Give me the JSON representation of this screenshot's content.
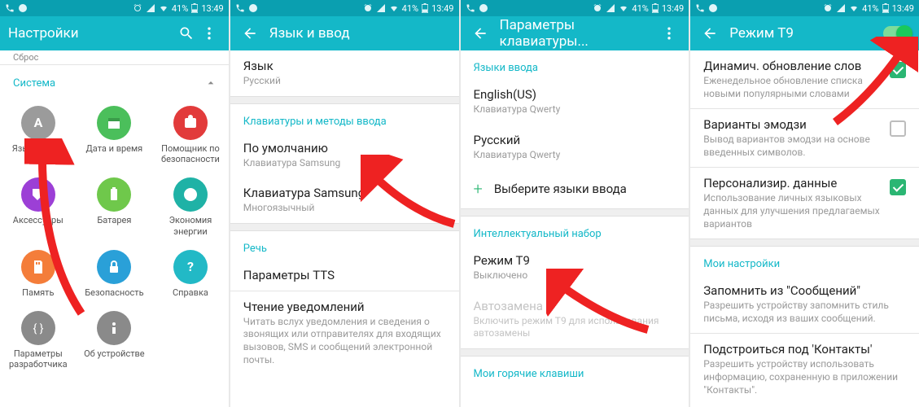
{
  "status": {
    "battery": "41%",
    "time": "13:49"
  },
  "p1": {
    "title": "Настройки",
    "truncated": "Сброс",
    "section": "Система",
    "items": [
      {
        "label": "Язык и ввод",
        "color": "#9b9b9b",
        "icon": "A"
      },
      {
        "label": "Дата и время",
        "color": "#4bbf5b",
        "icon": "cal"
      },
      {
        "label": "Помощник по безопасности",
        "color": "#e23b3b",
        "icon": "warn"
      },
      {
        "label": "Аксессуары",
        "color": "#9c3fd6",
        "icon": "tag"
      },
      {
        "label": "Батарея",
        "color": "#6fc84b",
        "icon": "bat"
      },
      {
        "label": "Экономия энергии",
        "color": "#1fb2a6",
        "icon": "leaf"
      },
      {
        "label": "Память",
        "color": "#f47d3a",
        "icon": "sd"
      },
      {
        "label": "Безопасность",
        "color": "#2aa0d8",
        "icon": "lock"
      },
      {
        "label": "Справка",
        "color": "#22b9c6",
        "icon": "help"
      },
      {
        "label": "Параметры разработчика",
        "color": "#8a8a8a",
        "icon": "dev"
      },
      {
        "label": "Об устройстве",
        "color": "#8a8a8a",
        "icon": "info"
      }
    ]
  },
  "p2": {
    "title": "Язык и ввод",
    "rows": [
      {
        "type": "item",
        "t": "Язык",
        "s": "Русский"
      },
      {
        "type": "div"
      },
      {
        "type": "header",
        "t": "Клавиатуры и методы ввода"
      },
      {
        "type": "item",
        "t": "По умолчанию",
        "s": "Клавиатура Samsung"
      },
      {
        "type": "item",
        "t": "Клавиатура Samsung",
        "s": "Многоязычный"
      },
      {
        "type": "div"
      },
      {
        "type": "header",
        "t": "Речь"
      },
      {
        "type": "item",
        "t": "Параметры TTS"
      },
      {
        "type": "hr"
      },
      {
        "type": "item",
        "t": "Чтение уведомлений",
        "s": "Читать вслух уведомления и сведения о звонящих или отправителях для входящих вызовов, SMS и сообщений электронной почты."
      }
    ]
  },
  "p3": {
    "title": "Параметры клавиатуры...",
    "rows": [
      {
        "type": "header",
        "t": "Языки ввода"
      },
      {
        "type": "item",
        "t": "English(US)",
        "s": "Клавиатура Qwerty"
      },
      {
        "type": "item",
        "t": "Русский",
        "s": "Клавиатура Qwerty"
      },
      {
        "type": "add",
        "t": "Выберите языки ввода"
      },
      {
        "type": "div"
      },
      {
        "type": "header",
        "t": "Интеллектуальный набор"
      },
      {
        "type": "item",
        "t": "Режим Т9",
        "s": "Выключено"
      },
      {
        "type": "item",
        "t": "Автозамена",
        "s": "Включить режим Т9 для использования автозамены",
        "dis": true
      },
      {
        "type": "div"
      },
      {
        "type": "header",
        "t": "Мои горячие клавиши"
      }
    ]
  },
  "p4": {
    "title": "Режим Т9",
    "rows": [
      {
        "type": "check",
        "t": "Динамич. обновление слов",
        "s": "Еженедельное обновление списка новыми популярными словами",
        "on": true
      },
      {
        "type": "hr"
      },
      {
        "type": "check",
        "t": "Варианты эмодзи",
        "s": "Вывод вариантов эмодзи на основе введенных символов.",
        "on": false
      },
      {
        "type": "hr"
      },
      {
        "type": "check",
        "t": "Персонализир. данные",
        "s": "Использование личных языковых данных для улучшения предлагаемых вариантов",
        "on": true
      },
      {
        "type": "div"
      },
      {
        "type": "header",
        "t": "Мои настройки"
      },
      {
        "type": "item",
        "t": "Запомнить из \"Сообщений\"",
        "s": "Разрешить устройству запомнить стиль письма, исходя из ваших сообщений."
      },
      {
        "type": "hr"
      },
      {
        "type": "item",
        "t": "Подстроиться под 'Контакты'",
        "s": "Разрешить устройству использовать информацию, сохраненную в приложении \"Контакты\"."
      }
    ]
  }
}
